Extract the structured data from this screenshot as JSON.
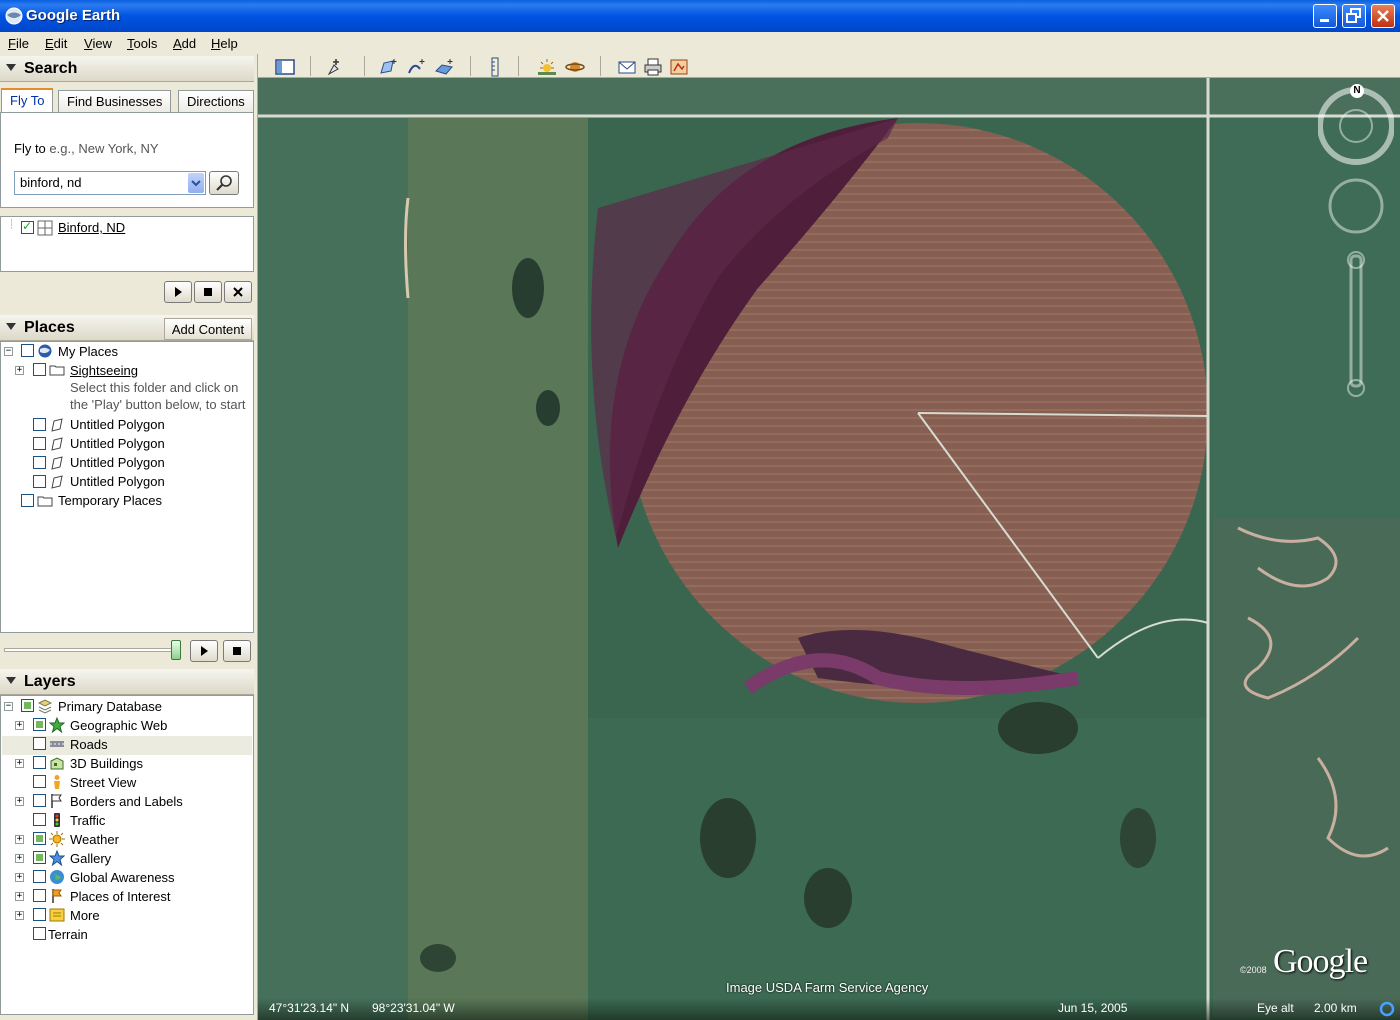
{
  "window": {
    "title": "Google Earth"
  },
  "menu": [
    "File",
    "Edit",
    "View",
    "Tools",
    "Add",
    "Help"
  ],
  "search": {
    "header": "Search",
    "tabs": [
      "Fly To",
      "Find Businesses",
      "Directions"
    ],
    "fly_to_label": "Fly to",
    "fly_to_hint": "e.g., New York, NY",
    "input_value": "binford, nd",
    "result": "Binford, ND"
  },
  "places": {
    "header": "Places",
    "add_content": "Add Content",
    "items": {
      "my_places": "My Places",
      "sightseeing": "Sightseeing",
      "sightseeing_note_1": "Select this folder and click on",
      "sightseeing_note_2": "the 'Play' button below, to start",
      "polygon": "Untitled Polygon",
      "temporary": "Temporary Places"
    }
  },
  "layers": {
    "header": "Layers",
    "items": [
      "Primary Database",
      "Geographic Web",
      "Roads",
      "3D Buildings",
      "Street View",
      "Borders and Labels",
      "Traffic",
      "Weather",
      "Gallery",
      "Global Awareness",
      "Places of Interest",
      "More",
      "Terrain"
    ]
  },
  "map": {
    "credit": "Image USDA Farm Service Agency",
    "copyright": "©2008",
    "logo": "Google",
    "compass_north": "N"
  },
  "status": {
    "lat": "47°31'23.14\" N",
    "lon": "98°23'31.04\" W",
    "date": "Jun 15, 2005",
    "eye_alt_label": "Eye alt",
    "eye_alt_value": "2.00 km"
  },
  "colors": {
    "titlebar": "#0054e3",
    "accent_tab": "#e68b2c",
    "link": "#0000cc"
  }
}
